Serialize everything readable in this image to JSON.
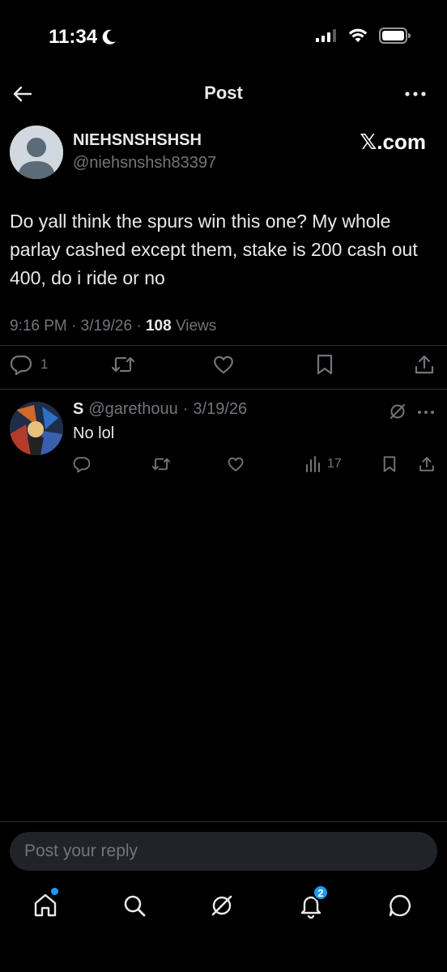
{
  "status_bar": {
    "time": "11:34"
  },
  "header": {
    "title": "Post"
  },
  "post": {
    "author_name": "NIEHSNSHSHSH",
    "author_handle": "@niehsnshsh83397",
    "brand": "𝕏.com",
    "text": "Do yall think the spurs win this one? My whole parlay cashed except them, stake is 200 cash out 400, do i ride or no",
    "time": "9:16 PM",
    "date": "3/19/26",
    "views_count": "108",
    "views_label": "Views",
    "reply_count": "1"
  },
  "reply": {
    "name": "S",
    "handle": "@garethouu",
    "date": "3/19/26",
    "text": "No lol",
    "views_count": "17"
  },
  "composer": {
    "placeholder": "Post your reply"
  },
  "nav": {
    "notification_badge": "2"
  },
  "colors": {
    "accent": "#1d9bf0",
    "muted": "#71767b",
    "text": "#e7e9ea",
    "background": "#000000"
  }
}
